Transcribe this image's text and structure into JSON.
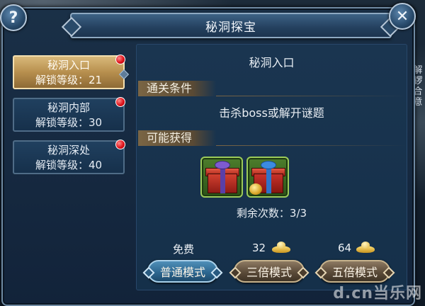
{
  "window": {
    "title": "秘洞探宝"
  },
  "controls": {
    "help_label": "?",
    "close_label": "✕"
  },
  "side_text": "解锣合意",
  "tabs": [
    {
      "name": "秘洞入口",
      "unlock": "解锁等级：21",
      "active": true
    },
    {
      "name": "秘洞内部",
      "unlock": "解锁等级：30",
      "active": false
    },
    {
      "name": "秘洞深处",
      "unlock": "解锁等级：40",
      "active": false
    }
  ],
  "content": {
    "title": "秘洞入口",
    "condition_header": "通关条件",
    "condition_text": "击杀boss或解开谜题",
    "rewards_header": "可能获得",
    "rewards": [
      {
        "icon": "purple-gift-box-icon"
      },
      {
        "icon": "blue-gift-box-with-coin-icon"
      }
    ],
    "remaining": "剩余次数：3/3"
  },
  "modes": [
    {
      "price": "免费",
      "label": "普通模式",
      "cost_icon": null
    },
    {
      "price": "32",
      "label": "三倍模式",
      "cost_icon": "gold-ingot-icon"
    },
    {
      "price": "64",
      "label": "五倍模式",
      "cost_icon": "gold-ingot-icon"
    }
  ],
  "watermark": "d.cn当乐网",
  "colors": {
    "active_tab": "#c9a463",
    "primary_button": "#3a7aa6",
    "notification_dot": "#e0141c",
    "reward_frame": "#9ccb5a"
  }
}
